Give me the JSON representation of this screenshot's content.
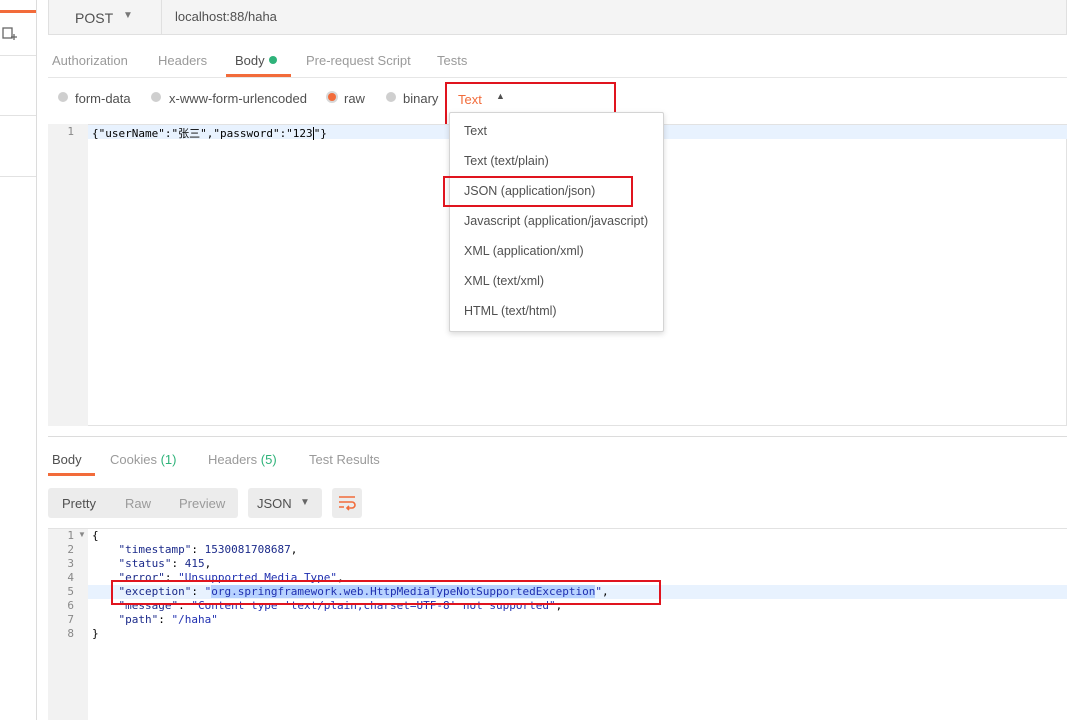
{
  "request": {
    "method": "POST",
    "url": "localhost:88/haha",
    "tabs": [
      {
        "label": "Authorization"
      },
      {
        "label": "Headers"
      },
      {
        "label": "Body"
      },
      {
        "label": "Pre-request Script"
      },
      {
        "label": "Tests"
      }
    ],
    "body_types": [
      "form-data",
      "x-www-form-urlencoded",
      "raw",
      "binary"
    ],
    "selected_body_type": "raw",
    "content_type_selected": "Text",
    "editor": {
      "line_number": "1",
      "code_before_cursor": "{\"userName\":\"张三\",\"password\":\"123",
      "code_after_cursor": "\"}"
    }
  },
  "dropdown": {
    "options": [
      "Text",
      "Text (text/plain)",
      "JSON (application/json)",
      "Javascript (application/javascript)",
      "XML (application/xml)",
      "XML (text/xml)",
      "HTML (text/html)"
    ],
    "highlighted": "JSON (application/json)"
  },
  "response": {
    "tabs": {
      "body": "Body",
      "cookies": "Cookies",
      "cookies_count": "(1)",
      "headers": "Headers",
      "headers_count": "(5)",
      "test_results": "Test Results"
    },
    "view_buttons": [
      "Pretty",
      "Raw",
      "Preview"
    ],
    "format": "JSON",
    "line_numbers": [
      "1",
      "2",
      "3",
      "4",
      "5",
      "6",
      "7",
      "8"
    ],
    "json": {
      "open": "{",
      "timestamp_key": "\"timestamp\"",
      "timestamp_val": "1530081708687",
      "status_key": "\"status\"",
      "status_val": "415",
      "error_key": "\"error\"",
      "error_val": "\"Unsupported Media Type\"",
      "exception_key": "\"exception\"",
      "exception_val": "org.springframework.web.HttpMediaTypeNotSupportedException",
      "message_key": "\"message\"",
      "message_val": "\"Content type 'text/plain;charset=UTF-8' not supported\"",
      "path_key": "\"path\"",
      "path_val": "\"/haha\"",
      "close": "}"
    }
  },
  "colors": {
    "accent": "#f26b3a",
    "green": "#2fb37a",
    "annotation_red": "#e0141e"
  }
}
